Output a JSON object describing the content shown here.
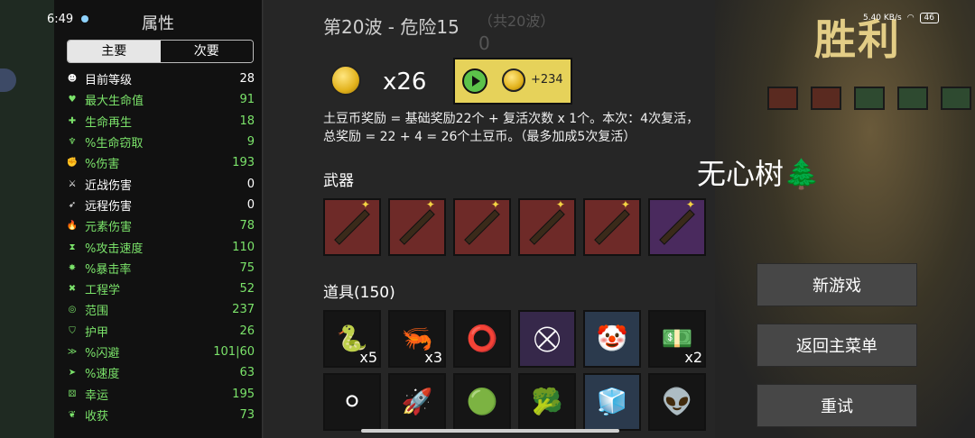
{
  "status_bar": {
    "time": "6:49",
    "signal": "5.40 KB/s",
    "battery": "46"
  },
  "stats_panel": {
    "title": "属性",
    "tabs": [
      {
        "label": "主要",
        "active": true
      },
      {
        "label": "次要",
        "active": false
      }
    ],
    "stats": [
      {
        "label": "目前等级",
        "value": "28",
        "color": "#ffffff",
        "icon": "level-icon"
      },
      {
        "label": "最大生命值",
        "value": "91",
        "color": "#7be36a",
        "icon": "heart-icon"
      },
      {
        "label": "生命再生",
        "value": "18",
        "color": "#7be36a",
        "icon": "regen-icon"
      },
      {
        "label": "%生命窃取",
        "value": "9",
        "color": "#7be36a",
        "icon": "lifesteal-icon"
      },
      {
        "label": "%伤害",
        "value": "193",
        "color": "#7be36a",
        "icon": "damage-icon"
      },
      {
        "label": "近战伤害",
        "value": "0",
        "color": "#ffffff",
        "icon": "melee-icon"
      },
      {
        "label": "远程伤害",
        "value": "0",
        "color": "#ffffff",
        "icon": "ranged-icon"
      },
      {
        "label": "元素伤害",
        "value": "78",
        "color": "#7be36a",
        "icon": "elemental-icon"
      },
      {
        "label": "%攻击速度",
        "value": "110",
        "color": "#7be36a",
        "icon": "attack-speed-icon"
      },
      {
        "label": "%暴击率",
        "value": "75",
        "color": "#7be36a",
        "icon": "crit-icon"
      },
      {
        "label": "工程学",
        "value": "52",
        "color": "#7be36a",
        "icon": "engineering-icon"
      },
      {
        "label": "范围",
        "value": "237",
        "color": "#7be36a",
        "icon": "range-icon"
      },
      {
        "label": "护甲",
        "value": "26",
        "color": "#7be36a",
        "icon": "armor-icon"
      },
      {
        "label": "%闪避",
        "value": "101|60",
        "color": "#7be36a",
        "icon": "dodge-icon"
      },
      {
        "label": "%速度",
        "value": "63",
        "color": "#7be36a",
        "icon": "speed-icon"
      },
      {
        "label": "幸运",
        "value": "195",
        "color": "#7be36a",
        "icon": "luck-icon"
      },
      {
        "label": "收获",
        "value": "73",
        "color": "#7be36a",
        "icon": "harvest-icon"
      }
    ]
  },
  "header": {
    "wave": "第20波 - 危险15",
    "total_waves": "（共20波）",
    "total_value": "0"
  },
  "reward": {
    "coin_count": "x26",
    "ad_bonus": "+234",
    "explanation_line1": "土豆币奖励 = 基础奖励22个 + 复活次数 x 1个。本次：4次复活，",
    "explanation_line2": "总奖励 = 22 + 4 = 26个土豆币。（最多加成5次复活）"
  },
  "weapons": {
    "title": "武器",
    "slots": [
      {
        "name": "magic-wand-icon",
        "tier": "red"
      },
      {
        "name": "magic-wand-icon",
        "tier": "red"
      },
      {
        "name": "magic-wand-icon",
        "tier": "red"
      },
      {
        "name": "magic-wand-icon",
        "tier": "red"
      },
      {
        "name": "magic-wand-icon",
        "tier": "red"
      },
      {
        "name": "magic-wand-icon",
        "tier": "purple"
      }
    ]
  },
  "items": {
    "title": "道具(150)",
    "row1": [
      {
        "name": "snake-icon",
        "glyph": "🐍",
        "qty": "x5",
        "tier": "black"
      },
      {
        "name": "shrimp-icon",
        "glyph": "🦐",
        "qty": "x3",
        "tier": "black"
      },
      {
        "name": "ritual-circle-icon",
        "glyph": "⭕",
        "qty": "",
        "tier": "black"
      },
      {
        "name": "spiked-shield-icon",
        "glyph": "⛒",
        "qty": "",
        "tier": "purple"
      },
      {
        "name": "clown-mask-icon",
        "glyph": "🤡",
        "qty": "",
        "tier": "blue"
      },
      {
        "name": "banknote-icon",
        "glyph": "💵",
        "qty": "x2",
        "tier": "black"
      }
    ],
    "row2": [
      {
        "name": "pearls-icon",
        "glyph": "⚪",
        "qty": "",
        "tier": "black"
      },
      {
        "name": "rocket-icon",
        "glyph": "🚀",
        "qty": "",
        "tier": "black"
      },
      {
        "name": "slime-icon",
        "glyph": "🟢",
        "qty": "",
        "tier": "black"
      },
      {
        "name": "broccoli-icon",
        "glyph": "🥦",
        "qty": "",
        "tier": "black"
      },
      {
        "name": "ice-cube-icon",
        "glyph": "🧊",
        "qty": "",
        "tier": "blue"
      },
      {
        "name": "alien-icon",
        "glyph": "👽",
        "qty": "",
        "tier": "black"
      }
    ]
  },
  "right_panel": {
    "victory": "胜利",
    "watermark": "无心树🌲",
    "new_game": "新游戏",
    "main_menu": "返回主菜单",
    "retry": "重试"
  }
}
